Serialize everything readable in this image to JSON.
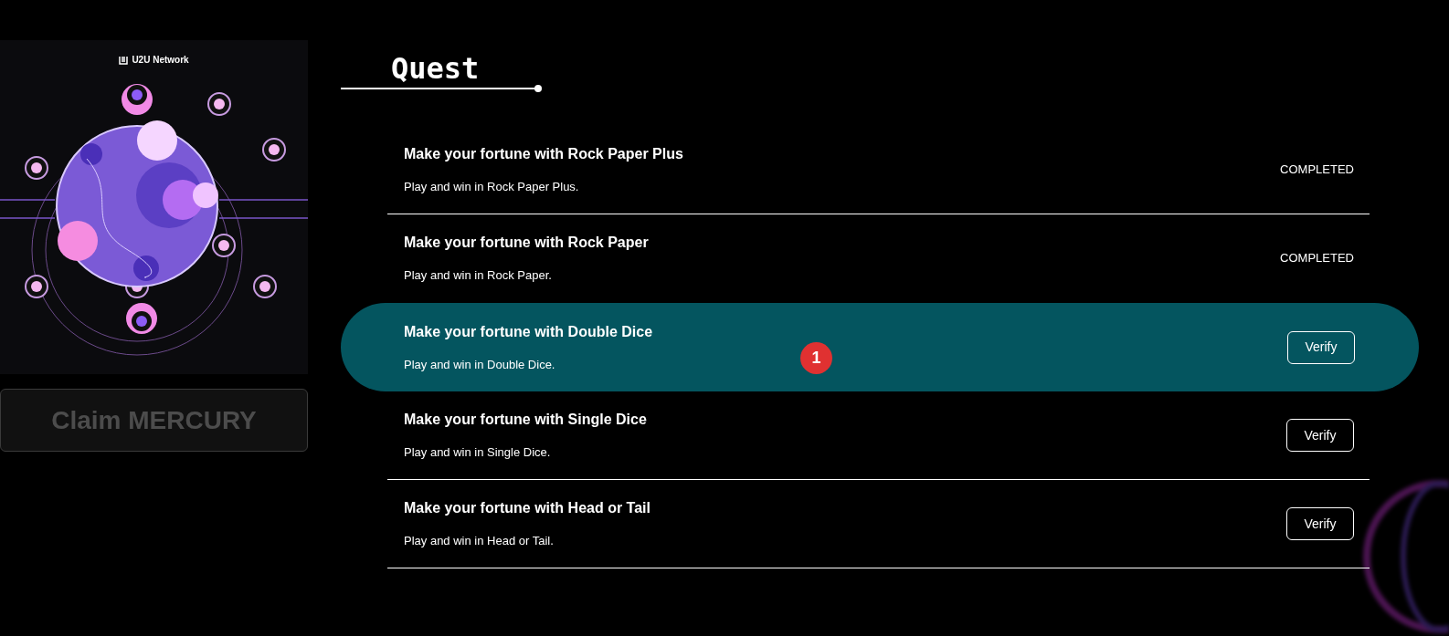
{
  "artwork": {
    "logo_text": "U2U Network"
  },
  "claim_button": {
    "label": "Claim MERCURY",
    "disabled": true
  },
  "quest": {
    "title": "Quest"
  },
  "step_marker": "1",
  "quests": [
    {
      "title": "Make your fortune with Rock Paper Plus",
      "description": "Play and win in Rock Paper Plus.",
      "kind": "completed",
      "status": "COMPLETED",
      "selected": false
    },
    {
      "title": "Make your fortune with Rock Paper",
      "description": "Play and win in Rock Paper.",
      "kind": "completed",
      "status": "COMPLETED",
      "selected": false
    },
    {
      "title": "Make your fortune with Double Dice",
      "description": "Play and win in Double Dice.",
      "kind": "verify",
      "status": "Verify",
      "selected": true
    },
    {
      "title": "Make your fortune with Single Dice",
      "description": "Play and win in Single Dice.",
      "kind": "verify",
      "status": "Verify",
      "selected": false
    },
    {
      "title": "Make your fortune with Head or Tail",
      "description": "Play and win in Head or Tail.",
      "kind": "verify",
      "status": "Verify",
      "selected": false
    }
  ]
}
